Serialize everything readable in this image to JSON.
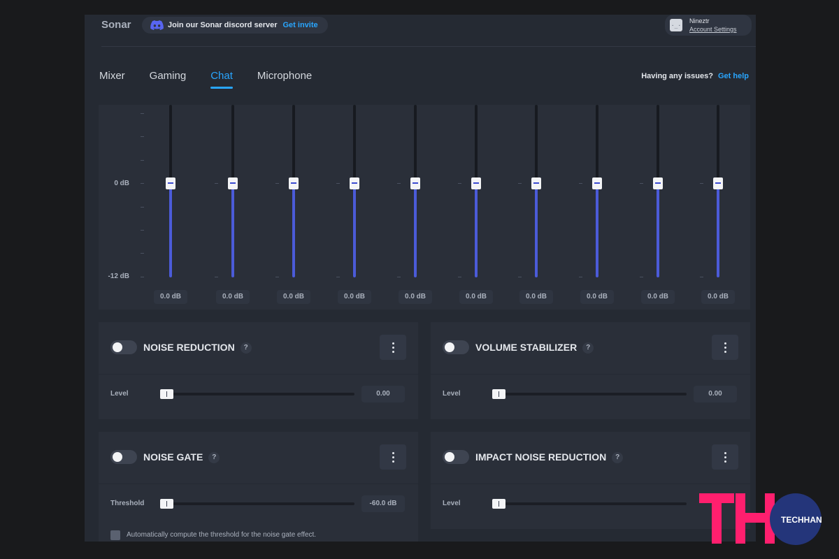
{
  "header": {
    "brand": "Sonar",
    "discord_text": "Join our Sonar discord server",
    "discord_link": "Get invite",
    "account_name": "Nineztr",
    "account_settings": "Account Settings"
  },
  "tabs": [
    {
      "label": "Mixer",
      "active": false
    },
    {
      "label": "Gaming",
      "active": false
    },
    {
      "label": "Chat",
      "active": true
    },
    {
      "label": "Microphone",
      "active": false
    }
  ],
  "help": {
    "text": "Having any issues?",
    "link": "Get help"
  },
  "equalizer": {
    "scale_labels": [
      "0 dB",
      "-12 dB"
    ],
    "bands": [
      {
        "value_label": "0.0 dB",
        "gain_db": 0.0
      },
      {
        "value_label": "0.0 dB",
        "gain_db": 0.0
      },
      {
        "value_label": "0.0 dB",
        "gain_db": 0.0
      },
      {
        "value_label": "0.0 dB",
        "gain_db": 0.0
      },
      {
        "value_label": "0.0 dB",
        "gain_db": 0.0
      },
      {
        "value_label": "0.0 dB",
        "gain_db": 0.0
      },
      {
        "value_label": "0.0 dB",
        "gain_db": 0.0
      },
      {
        "value_label": "0.0 dB",
        "gain_db": 0.0
      },
      {
        "value_label": "0.0 dB",
        "gain_db": 0.0
      },
      {
        "value_label": "0.0 dB",
        "gain_db": 0.0
      }
    ]
  },
  "effects": {
    "noise_reduction": {
      "title": "NOISE REDUCTION",
      "enabled": false,
      "param_label": "Level",
      "value": "0.00",
      "level": 0
    },
    "volume_stabilizer": {
      "title": "VOLUME STABILIZER",
      "enabled": false,
      "param_label": "Level",
      "value": "0.00",
      "level": 0
    },
    "noise_gate": {
      "title": "NOISE GATE",
      "enabled": false,
      "param_label": "Threshold",
      "value": "-60.0 dB",
      "level": 0,
      "checkbox_label": "Automatically compute the threshold for the noise gate effect."
    },
    "impact_noise_reduction": {
      "title": "IMPACT NOISE REDUCTION",
      "enabled": false,
      "param_label": "Level",
      "level": 0
    }
  },
  "help_mark": "?",
  "watermark": {
    "logo_text": "TH",
    "text": "TECHHANGOUT"
  },
  "colors": {
    "accent": "#29a6ff",
    "eq_fill": "#4b5bd8",
    "background": "#252a33",
    "watermark_pink": "#ff1f6e",
    "watermark_navy": "#24357a"
  }
}
